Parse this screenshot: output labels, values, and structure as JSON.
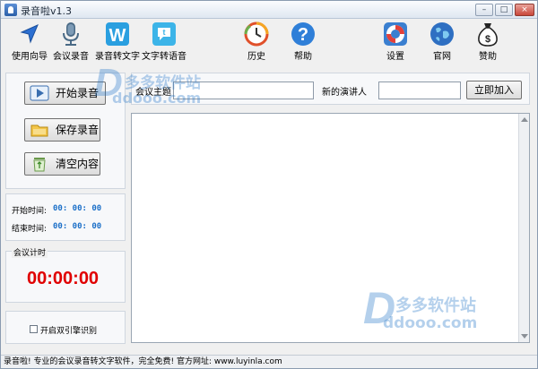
{
  "window": {
    "title": "录音啦v1.3",
    "controls": {
      "minimize": "–",
      "maximize": "□",
      "close": "×"
    }
  },
  "toolbar": {
    "items": [
      {
        "label": "使用向导",
        "icon": "navigation-arrow-icon"
      },
      {
        "label": "会议录音",
        "icon": "microphone-icon"
      },
      {
        "label": "录音转文字",
        "icon": "letter-w-icon"
      },
      {
        "label": "文字转语音",
        "icon": "speech-bubble-icon"
      },
      {
        "label": "历史",
        "icon": "history-clock-icon"
      },
      {
        "label": "帮助",
        "icon": "question-mark-icon"
      },
      {
        "label": "设置",
        "icon": "lifebuoy-icon"
      },
      {
        "label": "官网",
        "icon": "globe-icon"
      },
      {
        "label": "赞助",
        "icon": "money-bag-icon"
      }
    ]
  },
  "controls": {
    "start_record": "开始录音",
    "save_record": "保存录音",
    "clear_content": "清空内容"
  },
  "times": {
    "start_label": "开始时间:",
    "start_value": "00: 00: 00",
    "end_label": "结束时间:",
    "end_value": "00: 00: 00"
  },
  "meeting_timer": {
    "label": "会议计时",
    "value": "00:00:00"
  },
  "dual_engine": {
    "label": "开启双引擎识别",
    "checked": false
  },
  "meeting": {
    "topic_label": "会议主题",
    "topic_value": "",
    "speaker_label": "新的演讲人",
    "speaker_value": "",
    "join_button": "立即加入",
    "transcript": ""
  },
  "status": {
    "text": "录音啦! 专业的会议录音转文字软件，完全免费! 官方网址: www.luyinla.com"
  },
  "watermark": {
    "brand_cn": "多多软件站",
    "brand_url": "ddooo.com"
  },
  "colors": {
    "timer_red": "#e00000",
    "time_blue": "#1b6fc8",
    "watermark_blue": "#2878c8"
  }
}
